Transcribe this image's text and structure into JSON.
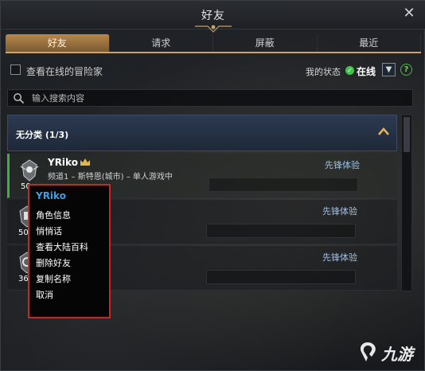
{
  "window": {
    "title": "好友"
  },
  "tabs": [
    {
      "label": "好友",
      "active": true
    },
    {
      "label": "请求",
      "active": false
    },
    {
      "label": "屏蔽",
      "active": false
    },
    {
      "label": "最近",
      "active": false
    }
  ],
  "filter": {
    "online_only_label": "查看在线的冒险家",
    "checked": false
  },
  "status": {
    "label": "我的状态",
    "value": "在线",
    "dropdown_icon": "chevron-down-icon",
    "help": "?"
  },
  "search": {
    "placeholder": "输入搜索内容"
  },
  "group": {
    "title": "无分类 (1/3)",
    "expanded": true
  },
  "friends": [
    {
      "name": "YRiko",
      "location": "频道1 – 斯特恩(城市) – 单人游戏中",
      "level": "50",
      "mode": "先锋体验",
      "leader": true,
      "selected": true
    },
    {
      "name": "",
      "location": "",
      "level": "50",
      "mode": "先锋体验",
      "leader": false,
      "selected": false
    },
    {
      "name": "",
      "location": "",
      "level": "36",
      "mode": "先锋体验",
      "leader": false,
      "selected": false
    }
  ],
  "context_menu": {
    "title": "YRiko",
    "items": [
      "角色信息",
      "悄悄话",
      "查看大陆百科",
      "删除好友",
      "复制名称",
      "取消"
    ]
  },
  "watermark": {
    "text": "九游"
  },
  "colors": {
    "accent_gold": "#caa46a",
    "online_green": "#43c34e",
    "highlight_red": "#c62828",
    "menu_title_blue": "#3aa0e6",
    "mode_blue": "#9fc2ea"
  }
}
